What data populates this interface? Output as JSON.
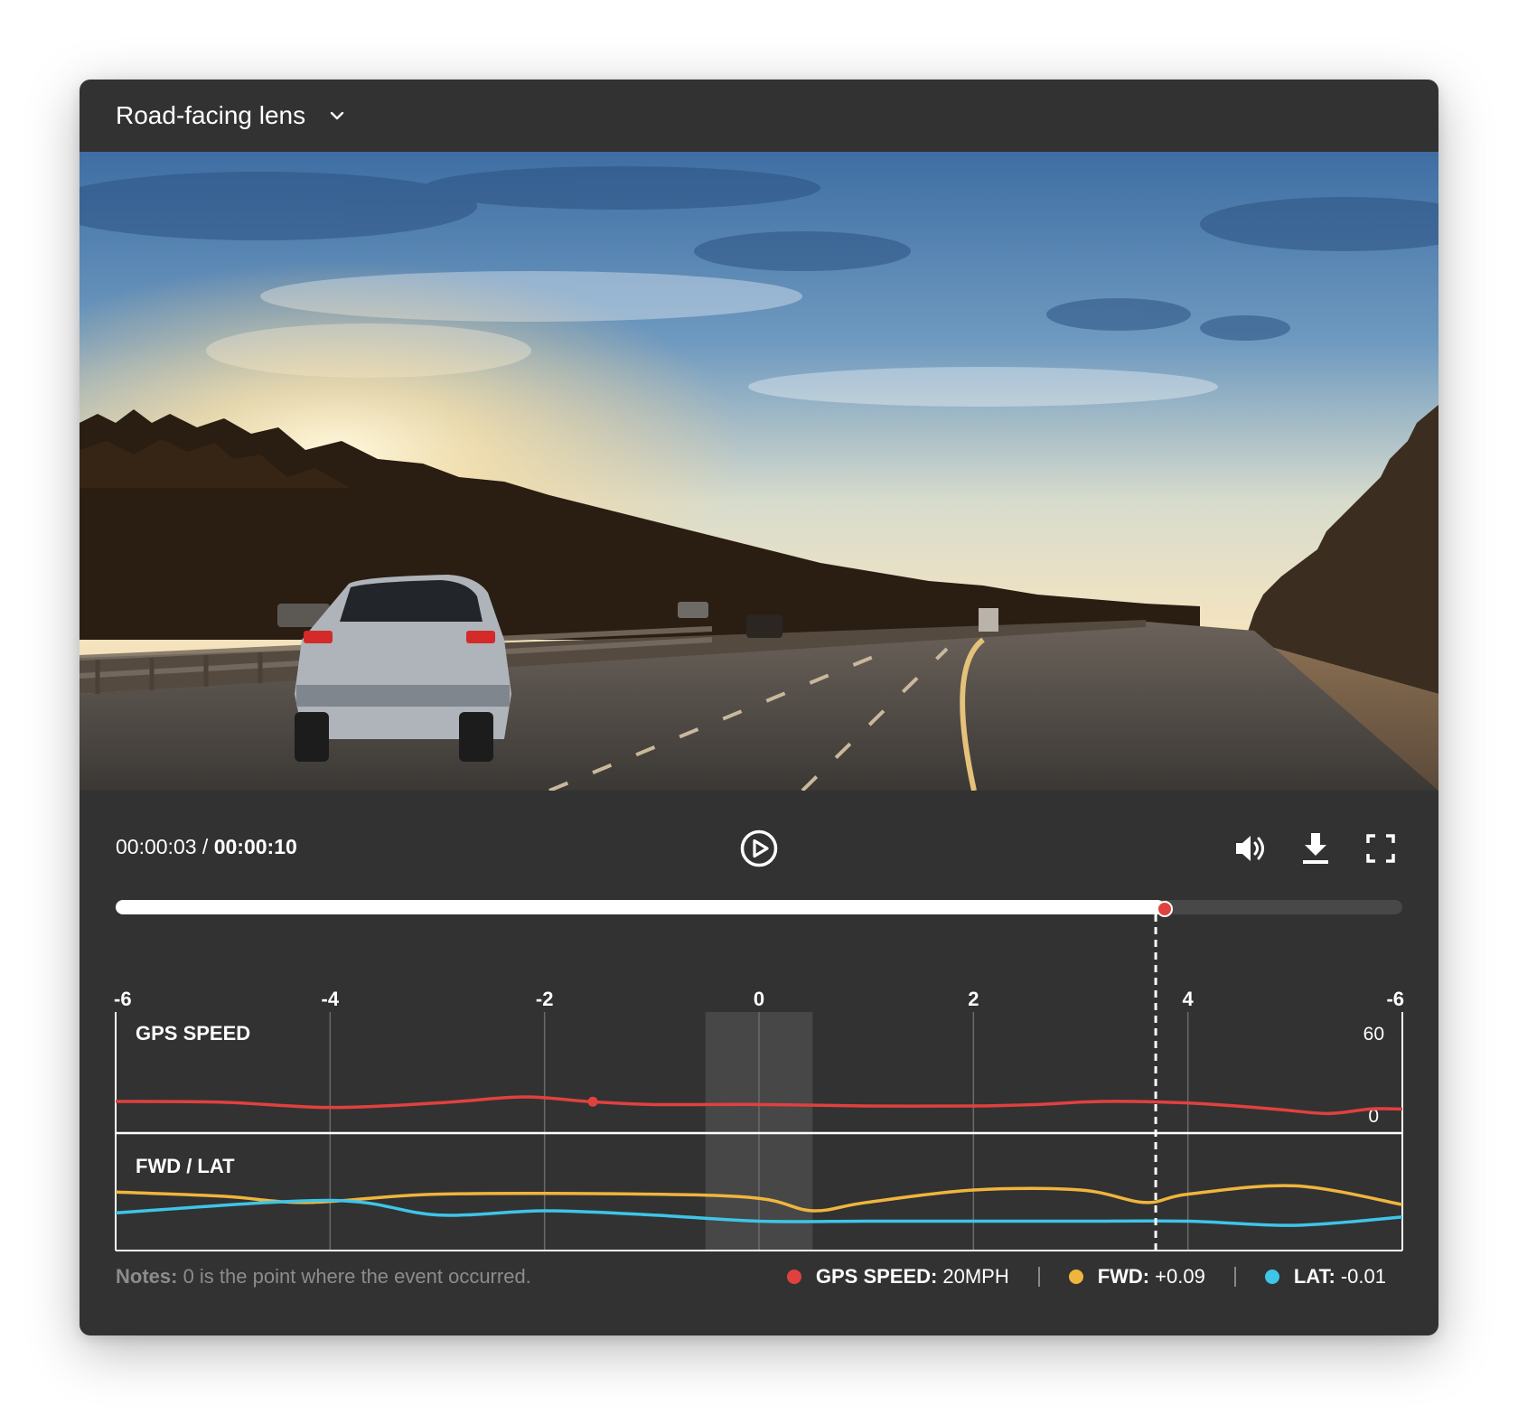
{
  "header": {
    "lens_label": "Road-facing lens"
  },
  "player": {
    "current_time": "00:00:03",
    "separator": " / ",
    "total_time": "00:00:10",
    "progress_fraction": 0.815
  },
  "chart_data": {
    "type": "line",
    "x_ticks": [
      "-6",
      "-4",
      "-2",
      "0",
      "2",
      "4",
      "-6"
    ],
    "x_range": [
      -6,
      6
    ],
    "event_window": [
      -0.5,
      0.5
    ],
    "playhead_x": 3.7,
    "panels": [
      {
        "title": "GPS SPEED",
        "y_max_label": "60",
        "y_min_label": "0",
        "series": [
          {
            "name": "GPS SPEED",
            "color": "#e0413f",
            "marker_x": -1.55,
            "points": [
              [
                -6,
                15
              ],
              [
                -5,
                14.5
              ],
              [
                -4,
                11
              ],
              [
                -3,
                14
              ],
              [
                -2.2,
                18
              ],
              [
                -1.6,
                15
              ],
              [
                -1,
                13
              ],
              [
                0,
                13
              ],
              [
                1,
                12
              ],
              [
                2,
                12
              ],
              [
                2.6,
                13
              ],
              [
                3.2,
                15
              ],
              [
                4,
                14
              ],
              [
                4.8,
                10
              ],
              [
                5.3,
                7
              ],
              [
                5.7,
                10
              ],
              [
                6,
                10
              ]
            ]
          }
        ]
      },
      {
        "title": "FWD / LAT",
        "series": [
          {
            "name": "FWD",
            "color": "#f0b53d",
            "points": [
              [
                -6,
                0.09
              ],
              [
                -5,
                0.07
              ],
              [
                -4.2,
                0.04
              ],
              [
                -3,
                0.08
              ],
              [
                -1,
                0.08
              ],
              [
                0,
                0.06
              ],
              [
                0.5,
                0.0
              ],
              [
                1,
                0.04
              ],
              [
                2,
                0.1
              ],
              [
                3,
                0.1
              ],
              [
                3.6,
                0.04
              ],
              [
                4,
                0.08
              ],
              [
                5,
                0.12
              ],
              [
                6,
                0.03
              ]
            ]
          },
          {
            "name": "LAT",
            "color": "#3ec5e8",
            "points": [
              [
                -6,
                -0.01
              ],
              [
                -4,
                0.05
              ],
              [
                -3,
                -0.02
              ],
              [
                -2,
                0.0
              ],
              [
                -1,
                -0.02
              ],
              [
                0,
                -0.05
              ],
              [
                1,
                -0.05
              ],
              [
                2,
                -0.05
              ],
              [
                3,
                -0.05
              ],
              [
                4,
                -0.05
              ],
              [
                5,
                -0.07
              ],
              [
                6,
                -0.03
              ]
            ]
          }
        ]
      }
    ]
  },
  "notes": {
    "label": "Notes:",
    "text": " 0 is the point where the event occurred."
  },
  "legend": [
    {
      "label": "GPS SPEED:",
      "value": " 20MPH",
      "color": "#e0413f"
    },
    {
      "label": "FWD:",
      "value": " +0.09",
      "color": "#f0b53d"
    },
    {
      "label": "LAT:",
      "value": " -0.01",
      "color": "#3ec5e8"
    }
  ],
  "icons": {
    "lens_dropdown": "chevron-down-icon",
    "play": "play-icon",
    "volume": "volume-icon",
    "download": "download-icon",
    "fullscreen": "fullscreen-icon"
  }
}
